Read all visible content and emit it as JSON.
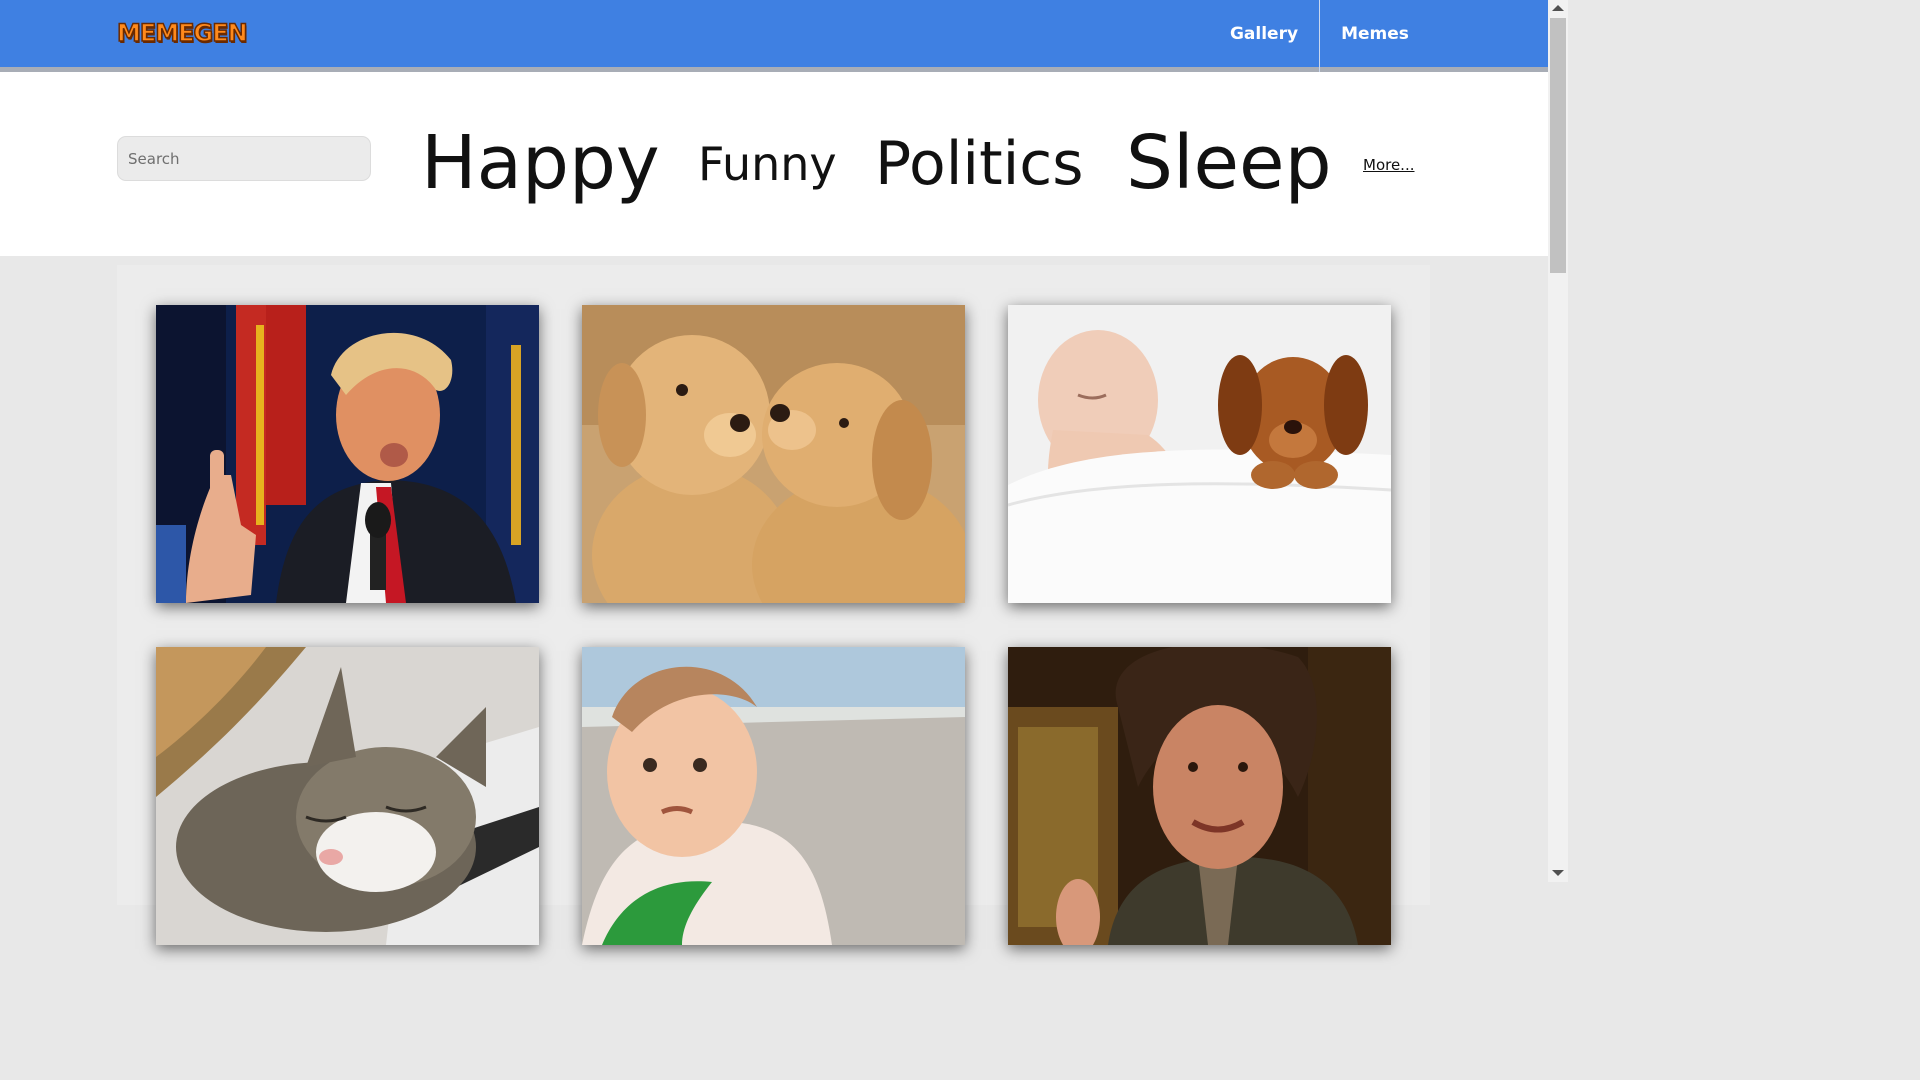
{
  "header": {
    "logo": "MEMEGEN",
    "nav": [
      {
        "label": "Gallery"
      },
      {
        "label": "Memes"
      }
    ]
  },
  "filter": {
    "search_placeholder": "Search",
    "keywords": [
      {
        "label": "Happy"
      },
      {
        "label": "Funny"
      },
      {
        "label": "Politics"
      },
      {
        "label": "Sleep"
      }
    ],
    "more_label": "More..."
  },
  "gallery": {
    "images": [
      {
        "subject": "man-speaking-at-podium"
      },
      {
        "subject": "two-puppies-kissing"
      },
      {
        "subject": "sleeping-baby-and-puppy"
      },
      {
        "subject": "sleeping-cat-on-laptop"
      },
      {
        "subject": "success-kid-on-beach"
      },
      {
        "subject": "man-with-wild-hair"
      }
    ]
  },
  "colors": {
    "topbar": "#3f80e2",
    "logo": "#ff8a1c"
  }
}
